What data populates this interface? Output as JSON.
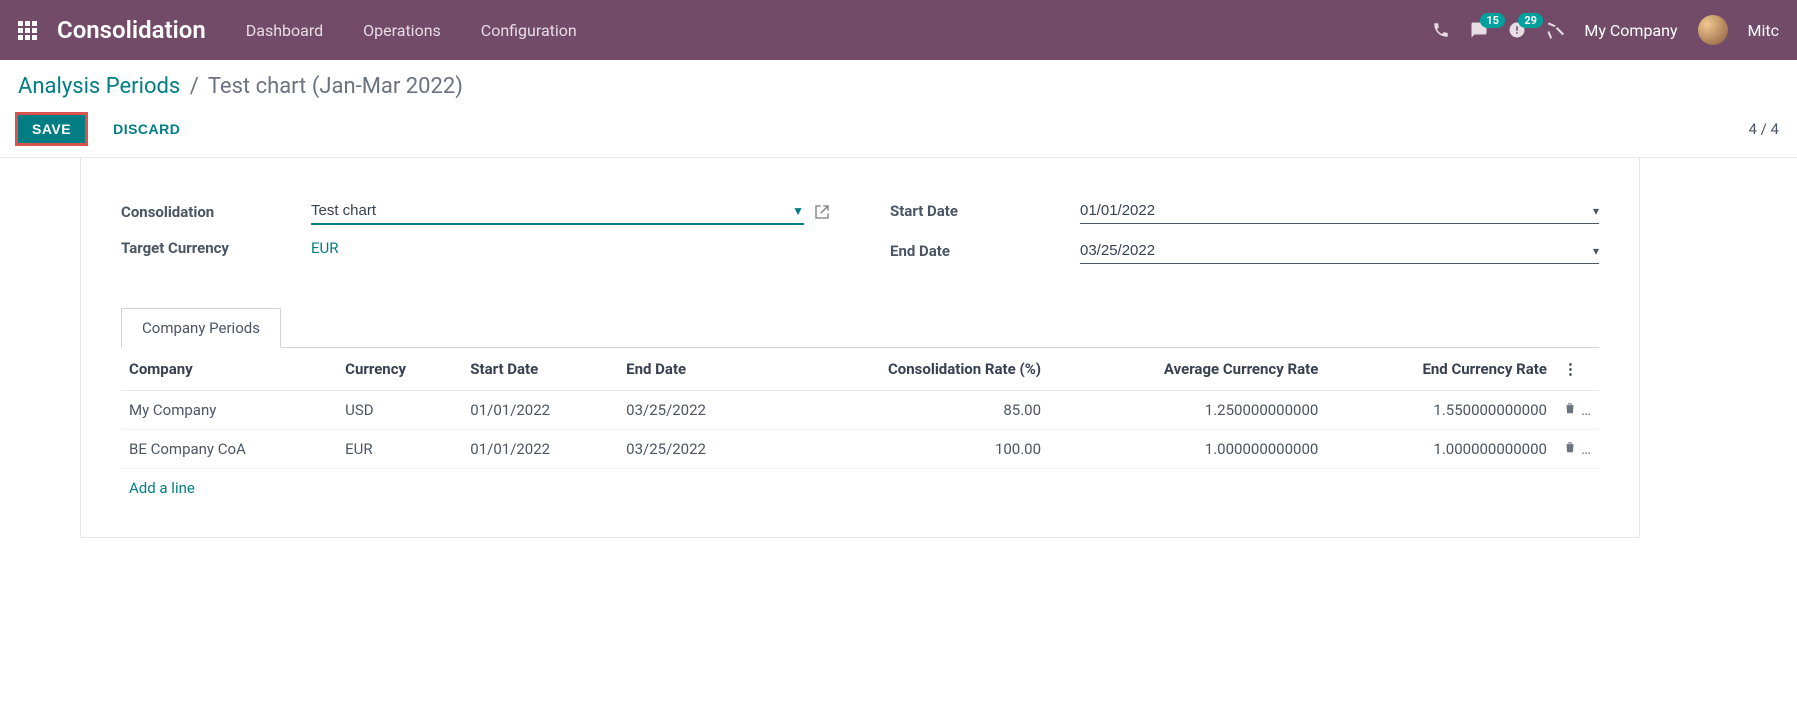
{
  "nav": {
    "brand": "Consolidation",
    "links": [
      "Dashboard",
      "Operations",
      "Configuration"
    ],
    "messages_badge": "15",
    "activities_badge": "29",
    "company": "My Company",
    "user": "Mitc"
  },
  "breadcrumb": {
    "parent": "Analysis Periods",
    "current": "Test chart (Jan-Mar 2022)"
  },
  "buttons": {
    "save": "SAVE",
    "discard": "DISCARD"
  },
  "pager": "4 / 4",
  "form": {
    "labels": {
      "consolidation": "Consolidation",
      "target_currency": "Target Currency",
      "start_date": "Start Date",
      "end_date": "End Date"
    },
    "values": {
      "consolidation": "Test chart",
      "target_currency": "EUR",
      "start_date": "01/01/2022",
      "end_date": "03/25/2022"
    }
  },
  "tabs": {
    "company_periods": "Company Periods"
  },
  "table": {
    "headers": {
      "company": "Company",
      "currency": "Currency",
      "start_date": "Start Date",
      "end_date": "End Date",
      "consolidation_rate": "Consolidation Rate (%)",
      "avg_rate": "Average Currency Rate",
      "end_rate": "End Currency Rate"
    },
    "rows": [
      {
        "company": "My Company",
        "currency": "USD",
        "start_date": "01/01/2022",
        "end_date": "03/25/2022",
        "consolidation_rate": "85.00",
        "avg_rate": "1.250000000000",
        "end_rate": "1.550000000000"
      },
      {
        "company": "BE Company CoA",
        "currency": "EUR",
        "start_date": "01/01/2022",
        "end_date": "03/25/2022",
        "consolidation_rate": "100.00",
        "avg_rate": "1.000000000000",
        "end_rate": "1.000000000000"
      }
    ],
    "add_line": "Add a line"
  }
}
